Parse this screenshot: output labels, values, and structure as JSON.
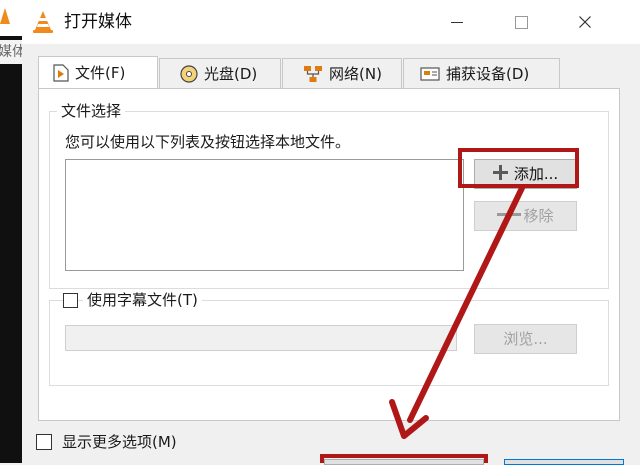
{
  "background_app": {
    "text": "媒体"
  },
  "window": {
    "title": "打开媒体"
  },
  "tabs": [
    {
      "label": "文件(F)",
      "icon": "file-play-icon",
      "active": true
    },
    {
      "label": "光盘(D)",
      "icon": "disc-icon",
      "active": false
    },
    {
      "label": "网络(N)",
      "icon": "network-icon",
      "active": false
    },
    {
      "label": "捕获设备(D)",
      "icon": "capture-card-icon",
      "active": false
    }
  ],
  "file_selection": {
    "group_label": "文件选择",
    "hint": "您可以使用以下列表及按钮选择本地文件。",
    "add_button": "添加...",
    "remove_button": "移除"
  },
  "subtitle": {
    "checkbox_label": "使用字幕文件(T)",
    "checked": false,
    "browse_button": "浏览..."
  },
  "more_options": {
    "label": "显示更多选项(M)",
    "checked": false
  },
  "colors": {
    "annotation": "#b01818",
    "vlc_orange": "#f08a1c",
    "panel_bg": "#f0f0f0"
  }
}
